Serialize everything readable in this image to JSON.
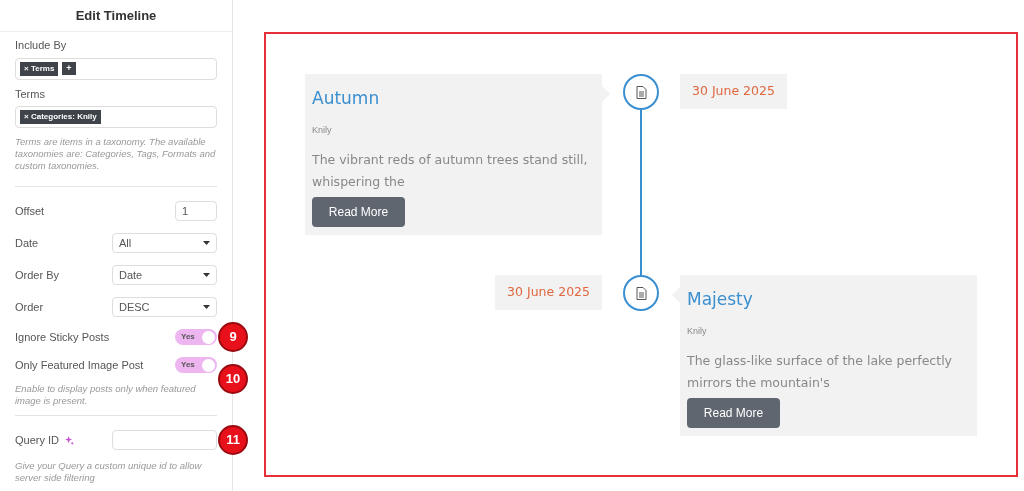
{
  "panel": {
    "title": "Edit Timeline",
    "controls": [
      {
        "kind": "tags",
        "label": "Include By",
        "tags": [
          {
            "remove": "×",
            "text": "Terms"
          }
        ],
        "add": "+"
      },
      {
        "kind": "tags",
        "label": "Terms",
        "tags": [
          {
            "remove": "×",
            "text": "Categories: Knily"
          }
        ],
        "help": "Terms are items in a taxonomy. The available taxonomies are: Categories, Tags, Formats and custom taxonomies."
      },
      {
        "kind": "divider"
      },
      {
        "kind": "number",
        "label": "Offset",
        "value": "1"
      },
      {
        "kind": "select",
        "label": "Date",
        "value": "All"
      },
      {
        "kind": "select",
        "label": "Order By",
        "value": "Date"
      },
      {
        "kind": "select",
        "label": "Order",
        "value": "DESC"
      },
      {
        "kind": "toggle",
        "label": "Ignore Sticky Posts",
        "on": true,
        "value": "Yes",
        "marker": "9"
      },
      {
        "kind": "toggle",
        "label": "Only Featured Image Post",
        "on": true,
        "value": "Yes",
        "marker": "10",
        "help": "Enable to display posts only when featured image is present."
      },
      {
        "kind": "divider"
      },
      {
        "kind": "text",
        "label": "Query ID",
        "marker": "11",
        "help": "Give your Query a custom unique id to allow server side filtering"
      }
    ]
  },
  "timeline": [
    {
      "kind": "left",
      "title": "Autumn",
      "author": "Knily",
      "excerpt": "The vibrant reds of autumn trees stand still, whispering the",
      "button": "Read More",
      "date": "30 June 2025"
    },
    {
      "kind": "right",
      "title": "Majesty",
      "author": "Knily",
      "excerpt": "The glass-like surface of the lake perfectly mirrors the mountain's",
      "button": "Read More",
      "date": "30 June 2025"
    }
  ]
}
